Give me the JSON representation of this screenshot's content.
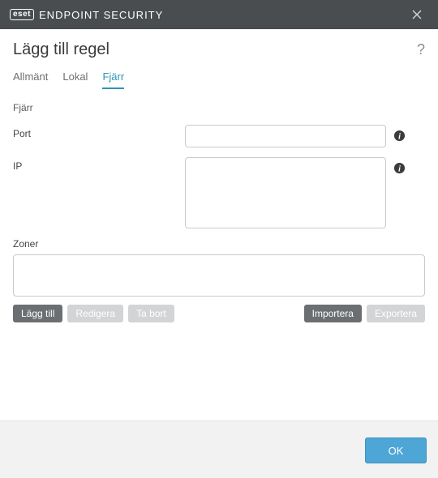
{
  "titlebar": {
    "brand_logo": "eset",
    "brand_text": "ENDPOINT SECURITY"
  },
  "header": {
    "title": "Lägg till regel"
  },
  "tabs": {
    "general": "Allmänt",
    "local": "Lokal",
    "remote": "Fjärr",
    "active": "remote"
  },
  "form": {
    "section_label": "Fjärr",
    "port_label": "Port",
    "port_value": "",
    "ip_label": "IP",
    "ip_value": "",
    "zones_label": "Zoner"
  },
  "buttons": {
    "add": "Lägg till",
    "edit": "Redigera",
    "delete": "Ta bort",
    "import": "Importera",
    "export": "Exportera",
    "ok": "OK"
  }
}
